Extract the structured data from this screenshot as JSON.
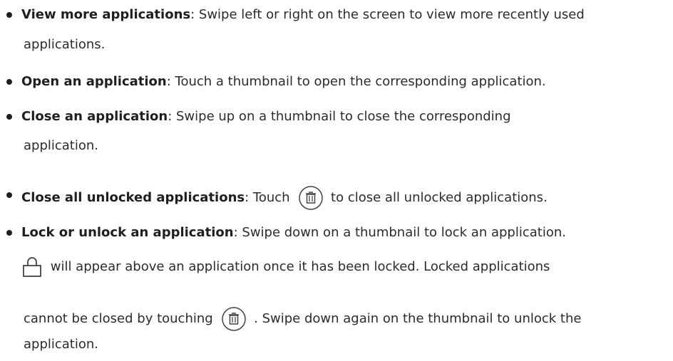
{
  "items": [
    {
      "title": "View more applications",
      "sep": ": ",
      "line1": "Swipe left or right on the screen to view more recently used",
      "line2": "applications."
    },
    {
      "title": "Open an application",
      "sep": ": ",
      "line1": "Touch a thumbnail to open the corresponding application."
    },
    {
      "title": "Close an application",
      "sep": ": ",
      "line1": "Swipe up on a thumbnail to close the corresponding",
      "line2": "application."
    },
    {
      "title": "Close all unlocked applications",
      "sep": ": ",
      "before_icon": "Touch ",
      "after_icon": " to close all unlocked applications."
    },
    {
      "title": "Lock or unlock an application",
      "sep": ": ",
      "line1": "Swipe down on a thumbnail to lock an application.",
      "line2_after_icon": " will appear above an application once it has been locked. Locked applications",
      "line3_before_icon": "cannot be closed by touching ",
      "line3_after_icon": " . Swipe down again on the thumbnail to unlock the",
      "line4": "application."
    }
  ],
  "icons": {
    "trash": "trash-circle-icon",
    "lock": "lock-icon"
  },
  "colors": {
    "text": "#2b2b2b",
    "icon_stroke": "#444444"
  }
}
